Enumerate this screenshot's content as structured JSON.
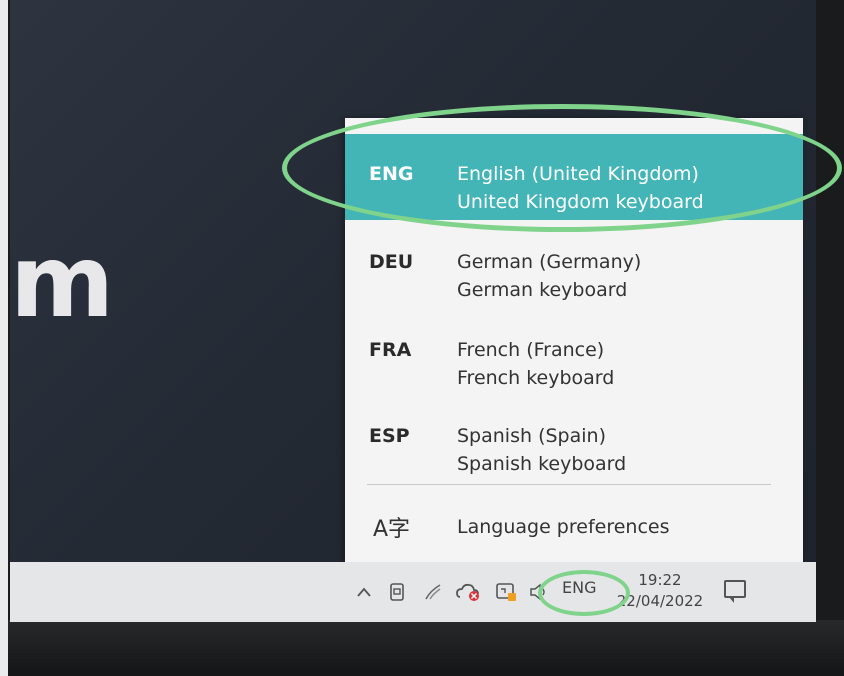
{
  "wallpaper": {
    "text": "m"
  },
  "flyout": {
    "languages": [
      {
        "code": "ENG",
        "name": "English (United Kingdom)",
        "keyboard": "United Kingdom keyboard",
        "selected": true
      },
      {
        "code": "DEU",
        "name": "German (Germany)",
        "keyboard": "German keyboard",
        "selected": false
      },
      {
        "code": "FRA",
        "name": "French (France)",
        "keyboard": "French keyboard",
        "selected": false
      },
      {
        "code": "ESP",
        "name": "Spanish (Spain)",
        "keyboard": "Spanish keyboard",
        "selected": false
      }
    ],
    "preferences_label": "Language preferences",
    "preferences_icon_glyph": "A字"
  },
  "taskbar": {
    "language_indicator": "ENG",
    "time": "19:22",
    "date": "22/04/2022",
    "tray_icons": [
      "chevron-up-icon",
      "meet-now-icon",
      "pen-icon",
      "onedrive-error-icon",
      "security-icon",
      "volume-icon"
    ]
  },
  "colors": {
    "selected_bg": "#44b5b7",
    "flyout_bg": "#f4f4f4",
    "taskbar_bg": "#e4e6e8",
    "annotation": "#7fd38a"
  }
}
